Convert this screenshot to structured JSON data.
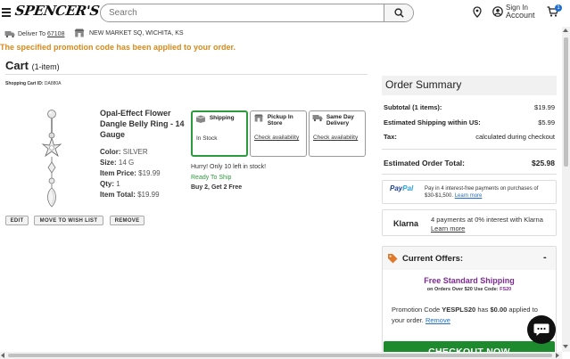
{
  "header": {
    "logo": "SPENCER'S",
    "search_placeholder": "Search",
    "signin_top": "Sign In",
    "signin_bottom": "Account",
    "cart_count": "1"
  },
  "location": {
    "deliver_label": "Deliver To",
    "zip": "67108",
    "store": "NEW MARKET SQ, WICHITA, KS"
  },
  "promo_message": "The specified promotion code has been applied to your order.",
  "cart": {
    "title": "Cart",
    "count": "(1-item)",
    "id_label": "Shopping Cart ID:",
    "id_value": "DA880A"
  },
  "product": {
    "name": "Opal-Effect Flower Dangle Belly Ring - 14 Gauge",
    "color_label": "Color:",
    "color_value": "SILVER",
    "size_label": "Size:",
    "size_value": "14 G",
    "price_label": "Item Price:",
    "price_value": "$19.99",
    "qty_label": "Qty:",
    "qty_value": "1",
    "total_label": "Item Total:",
    "total_value": "$19.99"
  },
  "fulfillment": {
    "shipping_title": "Shipping",
    "shipping_sub": "In Stock",
    "pickup_title": "Pickup In Store",
    "pickup_sub": "Check availability",
    "sameday_title": "Same Day Delivery",
    "sameday_sub": "Check availability"
  },
  "stock": {
    "hurry": "Hurry! Only 10 left in stock!",
    "ready": "Ready To Ship",
    "deal": "Buy 2, Get 2 Free"
  },
  "actions": {
    "edit": "EDIT",
    "wishlist": "MOVE TO WISH LIST",
    "remove": "REMOVE"
  },
  "summary": {
    "title": "Order Summary",
    "subtotal_label": "Subtotal (1 items):",
    "subtotal_value": "$19.99",
    "shipping_label": "Estimated Shipping within US:",
    "shipping_value": "$5.99",
    "tax_label": "Tax:",
    "tax_value": "calculated during checkout",
    "total_label": "Estimated Order Total:",
    "total_value": "$25.98"
  },
  "paypal": {
    "logo_1": "Pay",
    "logo_2": "Pal",
    "text": "Pay in 4 interest-free payments on purchases of $30-$1,500.",
    "link": "Learn more"
  },
  "klarna": {
    "logo": "Klarna",
    "text": "4 payments at 0% interest with Klarna",
    "link": "Learn more"
  },
  "offers": {
    "title": "Current Offers:",
    "toggle": "-",
    "free_ship": "Free Standard Shipping",
    "free_ship_sub": "on Orders Over $20 Use Code:",
    "free_ship_code": "FS20",
    "applied_1": "Promotion Code",
    "applied_code": "YESPLS20",
    "applied_2": "has",
    "applied_amount": "$0.00",
    "applied_3": "applied to your order.",
    "remove_link": "Remove",
    "checkout": "CHECKOUT NOW"
  }
}
